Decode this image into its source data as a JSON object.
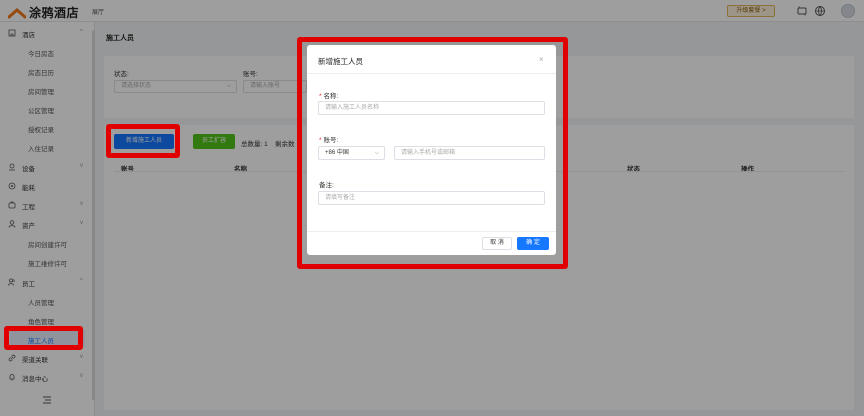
{
  "app": {
    "logo_text": "涂鸦酒店",
    "top_nav": "展厅",
    "upgrade_label": "升级套餐 >",
    "icons": [
      "refresh-icon",
      "globe-icon",
      "avatar"
    ]
  },
  "sidebar": {
    "groups": [
      {
        "label": "酒店",
        "icon": "building-icon",
        "arrow": "^"
      },
      {
        "label": "设备",
        "icon": "device-icon",
        "arrow": "v"
      },
      {
        "label": "能耗",
        "icon": "energy-icon",
        "arrow": ""
      },
      {
        "label": "工程",
        "icon": "engineering-icon",
        "arrow": "v"
      },
      {
        "label": "资产",
        "icon": "asset-icon",
        "arrow": "v"
      },
      {
        "label": "员工",
        "icon": "staff-icon",
        "arrow": "^"
      },
      {
        "label": "渠道关联",
        "icon": "link-icon",
        "arrow": "v"
      },
      {
        "label": "消息中心",
        "icon": "bell-icon",
        "arrow": "v"
      }
    ],
    "hotel_items": [
      "今日房态",
      "房态日历",
      "房间管理",
      "公区管理",
      "授权记录",
      "入住记录"
    ],
    "asset_items": [
      "房间创建许可",
      "施工维修许可"
    ],
    "staff_items": [
      "人员管理",
      "角色管理",
      "施工人员"
    ]
  },
  "main": {
    "page_title": "施工人员",
    "filter": {
      "status_label": "状态:",
      "status_placeholder": "请选择状态",
      "account_label": "账号:",
      "account_placeholder": "请输入账号"
    },
    "toolbar": {
      "add_label": "新增施工人员",
      "expand_label": "员工扩容",
      "total_label": "总数量: 1",
      "remain_label": "剩余数"
    },
    "columns": [
      "账号",
      "名称",
      "状态",
      "操作"
    ]
  },
  "modal": {
    "title": "新增施工人员",
    "close": "×",
    "name_label": "名称:",
    "name_placeholder": "请输入施工人员名称",
    "account_label": "账号:",
    "country_code": "+86 中国",
    "phone_placeholder": "请输入手机号或邮箱",
    "remark_label": "备注:",
    "remark_placeholder": "请填写备注",
    "cancel_label": "取 消",
    "ok_label": "确 定",
    "required_mark": "*"
  },
  "colors": {
    "primary": "#1677ff",
    "success": "#52c41a",
    "highlight": "#e00000"
  }
}
